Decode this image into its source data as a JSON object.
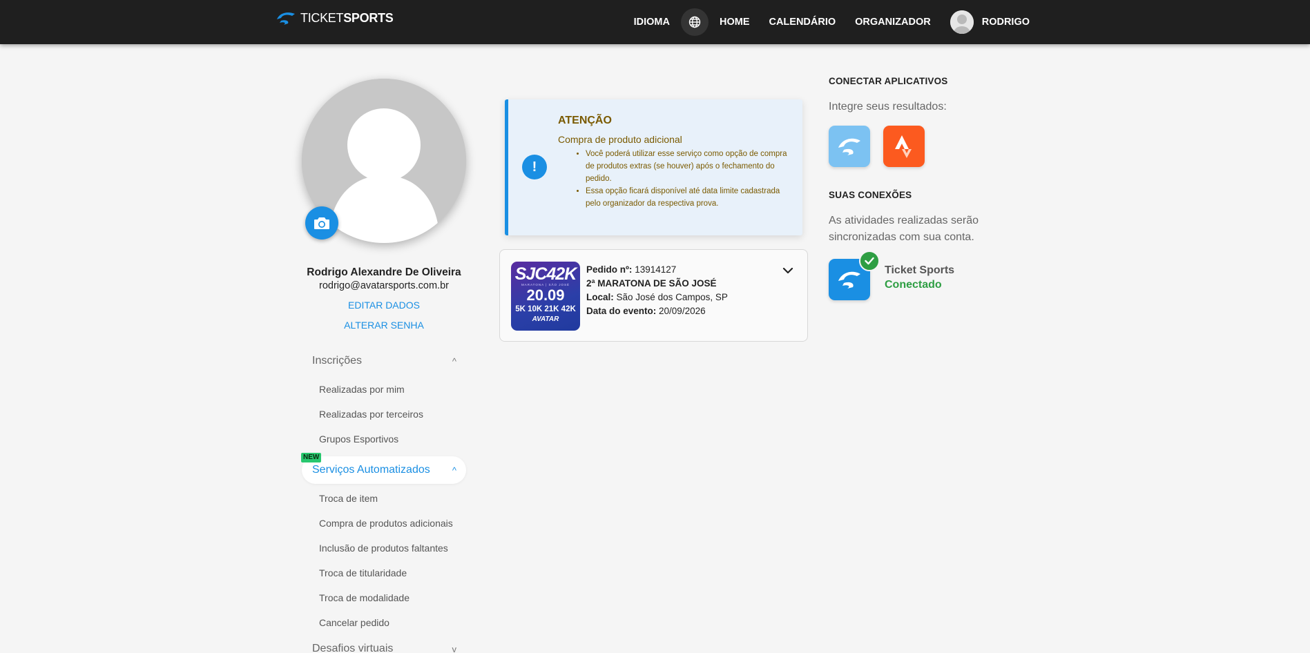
{
  "header": {
    "logo_light": "TICKET",
    "logo_bold": "SPORTS",
    "nav": {
      "language": "IDIOMA",
      "home": "HOME",
      "calendar": "CALENDÁRIO",
      "organizer": "ORGANIZADOR",
      "user": "RODRIGO"
    }
  },
  "profile": {
    "name": "Rodrigo Alexandre De Oliveira",
    "email": "rodrigo@avatarsports.com.br",
    "edit_label": "EDITAR DADOS",
    "password_label": "ALTERAR SENHA"
  },
  "sidebar": {
    "section1": {
      "label": "Inscrições",
      "items": [
        "Realizadas por mim",
        "Realizadas por terceiros",
        "Grupos Esportivos"
      ]
    },
    "new_badge": "NEW",
    "section2": {
      "label": "Serviços Automatizados",
      "items": [
        "Troca de item",
        "Compra de produtos adicionais",
        "Inclusão de produtos faltantes",
        "Troca de titularidade",
        "Troca de modalidade",
        "Cancelar pedido"
      ]
    },
    "section3": {
      "label": "Desafios virtuais"
    }
  },
  "alert": {
    "title": "ATENÇÃO",
    "subtitle": "Compra de produto adicional",
    "bullets": [
      "Você poderá utilizar esse serviço como opção de compra de produtos extras (se houver) após o fechamento do pedido.",
      "Essa opção ficará disponível até data limite cadastrada pelo organizador da respectiva prova."
    ]
  },
  "order": {
    "thumb": {
      "name": "SJC42K",
      "small": "MARATONA | SÃO JOSÉ",
      "date": "20.09",
      "distances": "5K 10K 21K 42K",
      "brand": "AVATAR"
    },
    "number_label": "Pedido nº:",
    "number": "13914127",
    "event": "2ª MARATONA DE SÃO JOSÉ",
    "location_label": "Local:",
    "location": "São José dos Campos, SP",
    "date_label": "Data do evento:",
    "date": "20/09/2026"
  },
  "apps": {
    "title": "CONECTAR APLICATIVOS",
    "text": "Integre seus resultados:",
    "connections_title": "SUAS CONEXÕES",
    "connections_text": "As atividades realizadas serão sincronizadas com sua conta.",
    "connected_app": "Ticket Sports",
    "connected_status": "Conectado"
  },
  "colors": {
    "accent": "#1a8fe3",
    "topbar": "#1f1f1f",
    "success": "#2e9e43",
    "warning_text": "#7a5a00",
    "strava": "#fc5a1f"
  }
}
